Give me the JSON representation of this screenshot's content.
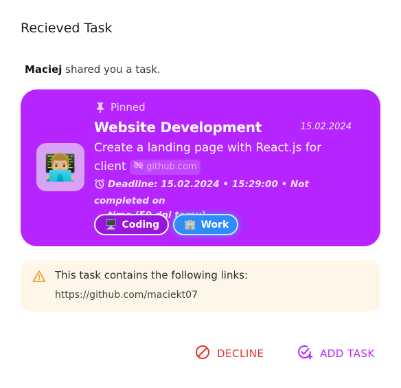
{
  "dialog": {
    "title": "Recieved Task",
    "sender_name": "Maciej",
    "shared_suffix": " shared you a task."
  },
  "task": {
    "emoji": "👨🏼‍💻",
    "pinned_label": "Pinned",
    "title": "Website Development",
    "date": "15.02.2024",
    "description": "Create a landing page with React.js for client",
    "link_chip": "github.com",
    "deadline_line1": "Deadline: 15.02.2024 • 15:29:00 • Not completed on",
    "deadline_line2": "time (59 dni temu)",
    "categories": [
      {
        "emoji": "🖥️",
        "label": "Coding",
        "color": "#9b16dd"
      },
      {
        "emoji": "🏢",
        "label": "Work",
        "color": "#2e8cf8"
      }
    ],
    "color": "#b624ff"
  },
  "notice": {
    "text": "This task contains the following links:",
    "link": "https://github.com/maciekt07"
  },
  "actions": {
    "decline": "DECLINE",
    "add": "ADD TASK"
  },
  "icons": {
    "pin": "push-pin-icon",
    "link": "link-off-icon",
    "clock": "alarm-clock-icon",
    "warning": "warning-icon",
    "decline": "block-icon",
    "add": "add-task-icon"
  }
}
